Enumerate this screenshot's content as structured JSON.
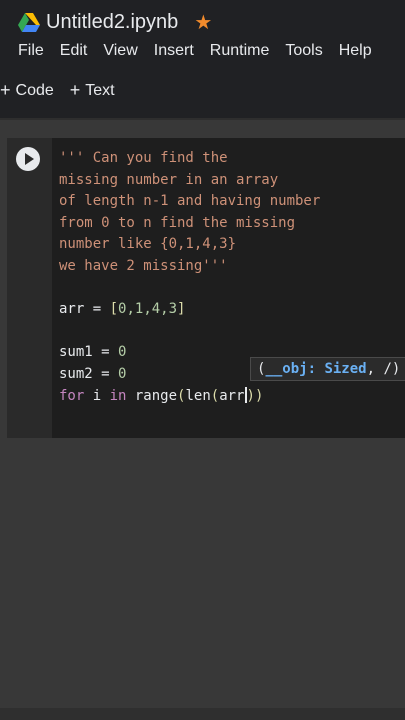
{
  "header": {
    "title": "Untitled2.ipynb",
    "menu": [
      "File",
      "Edit",
      "View",
      "Insert",
      "Runtime",
      "Tools",
      "Help"
    ],
    "toolbar": {
      "code_label": "Code",
      "text_label": "Text"
    }
  },
  "cell": {
    "lines": [
      "''' Can you find the",
      "missing number in an array",
      "of length n-1 and having number",
      "from 0 to n find the missing",
      "number like {0,1,4,3}",
      "we have 2 missing'''",
      "",
      "arr = [0,1,4,3]",
      "",
      "sum1 = 0",
      "sum2 = 0",
      "for i in range(len(arr))"
    ],
    "arr_code": {
      "var": "arr",
      "eq": " = ",
      "open": "[",
      "values": "0,1,4,3",
      "close": "]"
    },
    "sum1": {
      "var": "sum1",
      "eq": " = ",
      "val": "0"
    },
    "sum2": {
      "var": "sum2",
      "eq": " = ",
      "val": "0"
    },
    "for_line": {
      "kw_for": "for",
      "var": " i ",
      "kw_in": "in",
      "call": " range",
      "open1": "(",
      "call2": "len",
      "open2": "(",
      "arg": "arr",
      "close2": ")",
      "close1": ")"
    }
  },
  "tooltip": {
    "open": "(",
    "param": "__obj: Sized",
    "rest": ", /)"
  },
  "colors": {
    "accent_star": "#f28b2c",
    "string": "#ce9178",
    "keyword": "#c586c0",
    "number": "#b5cea8",
    "param": "#6ab0f3"
  }
}
